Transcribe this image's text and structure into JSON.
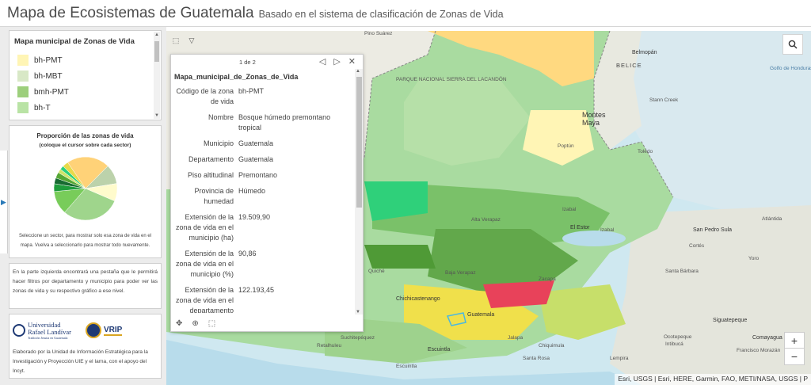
{
  "header": {
    "title": "Mapa de Ecosistemas de Guatemala",
    "subtitle": "Basado en el sistema de clasificación de Zonas de Vida"
  },
  "legend": {
    "title": "Mapa municipal de Zonas de Vida",
    "items": [
      {
        "label": "bh-PMT",
        "color": "#fff5b5"
      },
      {
        "label": "bh-MBT",
        "color": "#d8e8c6"
      },
      {
        "label": "bmh-PMT",
        "color": "#9dcf7c"
      },
      {
        "label": "bh-T",
        "color": "#b9e3a5"
      }
    ]
  },
  "pie_panel": {
    "title": "Proporción de las zonas de vida",
    "subtitle": "(coloque el cursor sobre cada sector)",
    "note": "Seleccione un sector, para mostrar solo esa zona de vida en el mapa. Vuelva a seleccionarlo para mostrar todo nuevamente."
  },
  "chart_data": {
    "type": "pie",
    "title": "Proporción de las zonas de vida",
    "values": [
      22,
      10,
      9,
      30,
      12,
      4,
      3,
      3,
      2,
      2,
      3
    ],
    "colors": [
      "#ffd278",
      "#bcd2ab",
      "#fffbcc",
      "#9fd58c",
      "#78cc5a",
      "#1e9c3b",
      "#176b31",
      "#56a835",
      "#cfe56a",
      "#2bd07c",
      "#e8d94a"
    ]
  },
  "info_text": "En la parte izquierda encontrará una pestaña que le permitirá hacer filtros por departamento y municipio para poder ver las zonas de vida y su respectivo gráfico a ese nivel.",
  "logos": {
    "url_line1": "Universidad",
    "url_line2": "Rafael Landívar",
    "url_line3": "Tradición Jesuita en Guatemala",
    "vrip": "VRIP"
  },
  "credits": "Elaborado por la Unidad de Información Estratégica para la Investigación y Proyección UIE y el Iarna, con el apoyo del Incyt.",
  "map": {
    "attribution": "Esri, USGS | Esri, HERE, Garmin, FAO, METI/NASA, USGS | P",
    "zoom_in": "+",
    "zoom_out": "−",
    "labels": [
      {
        "text": "Pino Suárez",
        "cls": ""
      },
      {
        "text": "BELICE",
        "cls": "big"
      },
      {
        "text": "Belmopán",
        "cls": "city"
      },
      {
        "text": "Golfo de Honduras",
        "cls": "water"
      },
      {
        "text": "Stann Creek",
        "cls": ""
      },
      {
        "text": "PARQUE NACIONAL SIERRA DEL LACANDÓN",
        "cls": ""
      },
      {
        "text": "Montes Maya",
        "cls": "mtn"
      },
      {
        "text": "Poptún",
        "cls": ""
      },
      {
        "text": "Toledo",
        "cls": ""
      },
      {
        "text": "Alta Verapaz",
        "cls": ""
      },
      {
        "text": "El Estor",
        "cls": "city"
      },
      {
        "text": "Izabal",
        "cls": ""
      },
      {
        "text": "Atlántida",
        "cls": ""
      },
      {
        "text": "San Pedro Sula",
        "cls": "city"
      },
      {
        "text": "Cortés",
        "cls": ""
      },
      {
        "text": "Yoro",
        "cls": ""
      },
      {
        "text": "Baja Verapaz",
        "cls": ""
      },
      {
        "text": "Zacapa",
        "cls": ""
      },
      {
        "text": "Santa Bárbara",
        "cls": ""
      },
      {
        "text": "Chichicastenango",
        "cls": "city"
      },
      {
        "text": "Guatemala",
        "cls": "city"
      },
      {
        "text": "Jalapa",
        "cls": ""
      },
      {
        "text": "Chiquimula",
        "cls": ""
      },
      {
        "text": "Siguatepeque",
        "cls": "city"
      },
      {
        "text": "Comayagua",
        "cls": "city"
      },
      {
        "text": "Escuintla",
        "cls": "city"
      },
      {
        "text": "Suchitepéquez",
        "cls": ""
      },
      {
        "text": "Retalhuleu",
        "cls": ""
      },
      {
        "text": "Santa Rosa",
        "cls": ""
      },
      {
        "text": "Lempira",
        "cls": ""
      },
      {
        "text": "Intibucá",
        "cls": ""
      },
      {
        "text": "Francisco Morazán",
        "cls": ""
      },
      {
        "text": "Ocotepeque",
        "cls": ""
      },
      {
        "text": "Izabal",
        "cls": ""
      },
      {
        "text": "Quiché",
        "cls": ""
      },
      {
        "text": "Escuintla",
        "cls": ""
      }
    ]
  },
  "popup": {
    "pager": "1 de 2",
    "title": "Mapa_municipal_de_Zonas_de_Vida",
    "rows": [
      {
        "key": "Código de la zona de vida",
        "value": "bh-PMT"
      },
      {
        "key": "Nombre",
        "value": "Bosque húmedo premontano tropical"
      },
      {
        "key": "Municipio",
        "value": "Guatemala"
      },
      {
        "key": "Departamento",
        "value": "Guatemala"
      },
      {
        "key": "Piso altitudinal",
        "value": "Premontano"
      },
      {
        "key": "Provincia de humedad",
        "value": "Húmedo"
      },
      {
        "key": "Extensión de la zona de vida en el municipio (ha)",
        "value": "19.509,90"
      },
      {
        "key": "Extensión de la zona de vida en el municipio (%)",
        "value": "90,86"
      },
      {
        "key": "Extensión de la zona de vida en el departamento",
        "value": "122.193,45"
      }
    ]
  }
}
